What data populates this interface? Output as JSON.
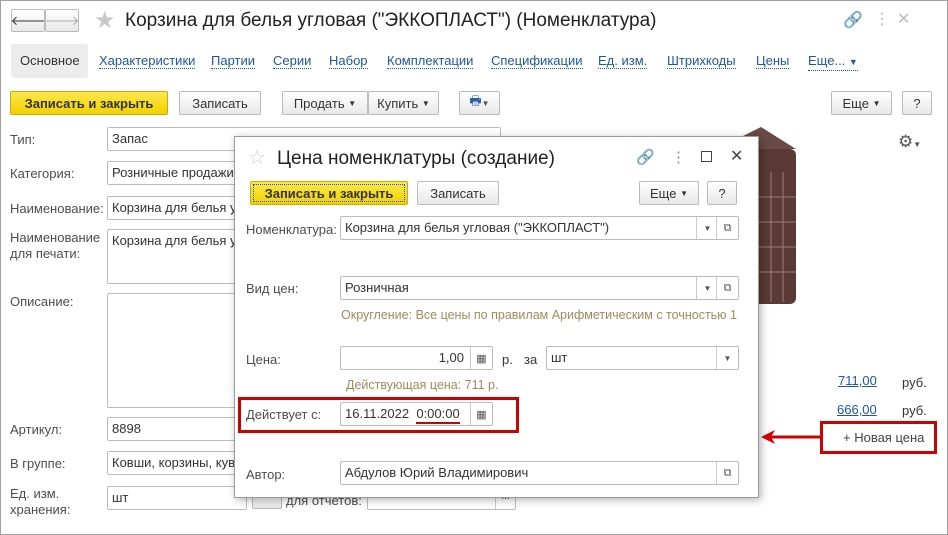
{
  "main": {
    "title": "Корзина для белья угловая (\"ЭККОПЛАСТ\") (Номенклатура)",
    "tabs": [
      "Основное",
      "Характеристики",
      "Партии",
      "Серии",
      "Набор",
      "Комплектации",
      "Спецификации",
      "Ед. изм.",
      "Штрихкоды",
      "Цены",
      "Еще..."
    ],
    "toolbar": {
      "save_close": "Записать и закрыть",
      "save": "Записать",
      "sell": "Продать",
      "buy": "Купить",
      "more": "Еще",
      "help": "?"
    },
    "fields": {
      "type_label": "Тип:",
      "type_value": "Запас",
      "category_label": "Категория:",
      "category_value": "Розничные продажи",
      "name_label": "Наименование:",
      "name_value": "Корзина для белья угловая",
      "print_name_label": "Наименование для печати:",
      "print_name_value": "Корзина для белья угловая",
      "description_label": "Описание:",
      "article_label": "Артикул:",
      "article_value": "8898",
      "group_label": "В группе:",
      "group_value": "Ковши, корзины, кувшины",
      "unit_label": "Ед. изм. хранения:",
      "unit_value": "шт",
      "reports_label": "для отчетов:",
      "reports_more": "..."
    },
    "prices": [
      {
        "value": "711,00",
        "currency": "руб."
      },
      {
        "value": "666,00",
        "currency": "руб."
      }
    ],
    "new_price": "+ Новая цена"
  },
  "dialog": {
    "title": "Цена номенклатуры (создание)",
    "save_close": "Записать и закрыть",
    "save": "Записать",
    "more": "Еще",
    "help": "?",
    "nomenclature_label": "Номенклатура:",
    "nomenclature_value": "Корзина для белья угловая (\"ЭККОПЛАСТ\")",
    "price_type_label": "Вид цен:",
    "price_type_value": "Розничная",
    "rounding_note": "Округление: Все цены по правилам Арифметическим с точностью 1",
    "price_label": "Цена:",
    "price_value": "1,00",
    "currency": "р.",
    "per": "за",
    "unit_value": "шт",
    "current_price": "Действующая цена: 711 р.",
    "valid_from_label": "Действует с:",
    "valid_date": "16.11.2022",
    "valid_time": "0:00:00",
    "author_label": "Автор:",
    "author_value": "Абдулов Юрий Владимирович"
  },
  "colors": {
    "accent": "#f2d200",
    "link": "#1c56a8",
    "highlight": "#d00000"
  }
}
